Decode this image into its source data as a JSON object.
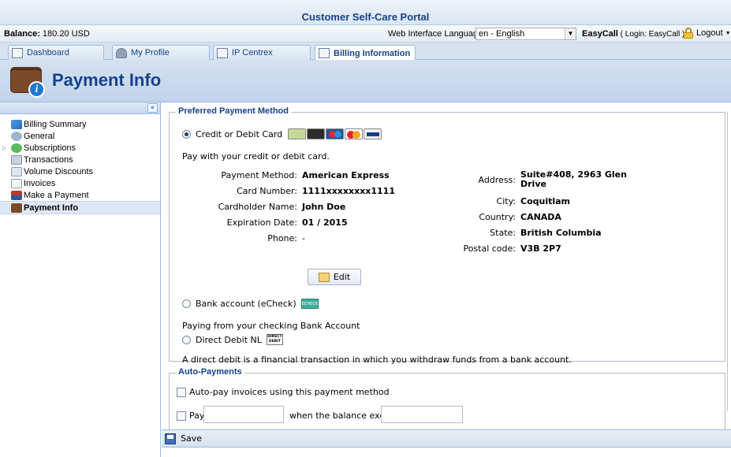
{
  "portal_title": "Customer Self-Care Portal",
  "info_bar": {
    "balance_label": "Balance:",
    "balance_value": "180.20 USD",
    "language_label": "Web Interface Language:",
    "language_value": "en - English",
    "user_name": "EasyCall",
    "user_login": "( Login: EasyCall )",
    "logout_label": "Logout"
  },
  "tabs": [
    {
      "label": "Dashboard"
    },
    {
      "label": "My Profile"
    },
    {
      "label": "IP Centrex"
    },
    {
      "label": "Billing Information"
    }
  ],
  "page_title": "Payment Info",
  "sidebar": {
    "items": [
      {
        "label": "Billing Summary"
      },
      {
        "label": "General"
      },
      {
        "label": "Subscriptions"
      },
      {
        "label": "Transactions"
      },
      {
        "label": "Volume Discounts"
      },
      {
        "label": "Invoices"
      },
      {
        "label": "Make a Payment"
      },
      {
        "label": "Payment Info"
      }
    ]
  },
  "preferred": {
    "legend": "Preferred Payment Method",
    "credit_option": "Credit or Debit Card",
    "credit_desc": "Pay with your credit or debit card.",
    "fields_left": [
      {
        "label": "Payment Method:",
        "value": "American Express"
      },
      {
        "label": "Card Number:",
        "value": "1111xxxxxxxx1111"
      },
      {
        "label": "Cardholder Name:",
        "value": "John Doe"
      },
      {
        "label": "Expiration Date:",
        "value": "01 / 2015"
      },
      {
        "label": "Phone:",
        "value": "-"
      }
    ],
    "fields_right": [
      {
        "label": "Address:",
        "value": "Suite#408, 2963 Glen Drive"
      },
      {
        "label": "City:",
        "value": "Coquitlam"
      },
      {
        "label": "Country:",
        "value": "CANADA"
      },
      {
        "label": "State:",
        "value": "British Columbia"
      },
      {
        "label": "Postal code:",
        "value": "V3B 2P7"
      }
    ],
    "edit_label": "Edit",
    "bank_option": "Bank account (eCheck)",
    "bank_desc": "Paying from your checking Bank Account",
    "dd_option": "Direct Debit NL",
    "dd_desc": "A direct debit is a financial transaction in which you withdraw funds from a bank account.",
    "echeck_icon_text": "ECHECK",
    "dd_icon_text": "DIRECT DEBIT"
  },
  "auto": {
    "legend": "Auto-Payments",
    "autopay_label": "Auto-pay invoices using this payment method",
    "pay_label": "Pay",
    "exceeds_label": "when the balance exceeds",
    "pay_value": "",
    "threshold_value": ""
  },
  "save_label": "Save"
}
